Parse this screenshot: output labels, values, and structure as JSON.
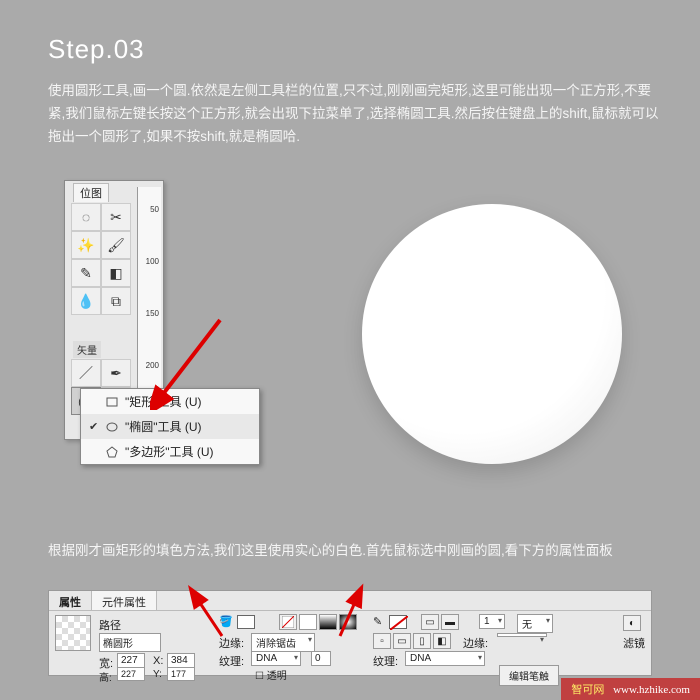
{
  "step_title": "Step.03",
  "instructions_1": "使用圆形工具,画一个圆.依然是左侧工具栏的位置,只不过,刚刚画完矩形,这里可能出现一个正方形,不要紧,我们鼠标左键长按这个正方形,就会出现下拉菜单了,选择椭圆工具.然后按住键盘上的shift,鼠标就可以拖出一个圆形了,如果不按shift,就是椭圆哈.",
  "instructions_2": "根据刚才画矩形的填色方法,我们这里使用实心的白色.首先鼠标选中刚画的圆,看下方的属性面板",
  "toolpanel": {
    "tab": "位图",
    "section": "矢量",
    "ruler_marks": [
      "50",
      "100",
      "150",
      "200"
    ]
  },
  "flyout": {
    "items": [
      {
        "label": "\"矩形\"工具 (U)",
        "selected": false,
        "shape": "rect"
      },
      {
        "label": "\"椭圆\"工具 (U)",
        "selected": true,
        "shape": "ellipse"
      },
      {
        "label": "\"多边形\"工具 (U)",
        "selected": false,
        "shape": "poly"
      }
    ]
  },
  "properties": {
    "tabs": [
      "属性",
      "元件属性"
    ],
    "active_tab": 0,
    "path_label": "路径",
    "shape_name": "椭圆形",
    "width_label": "宽:",
    "width": "227",
    "height_label": "高:",
    "height": "227",
    "x_label": "X:",
    "x": "384",
    "y_label": "Y:",
    "y": "177",
    "edge_label": "边缘:",
    "edge_value": "消除锯齿",
    "texture_label": "纹理:",
    "texture_value": "DNA",
    "texture_amount": "0",
    "texture2_label": "纹理:",
    "texture2_value": "DNA",
    "transparent_label": "透明",
    "none_label": "无",
    "edit_brush": "编辑笔触",
    "edge2_label": "边缘:",
    "filter_label": "滤镜"
  },
  "watermark": {
    "brand": "智可网",
    "url": "www.hzhike.com"
  }
}
